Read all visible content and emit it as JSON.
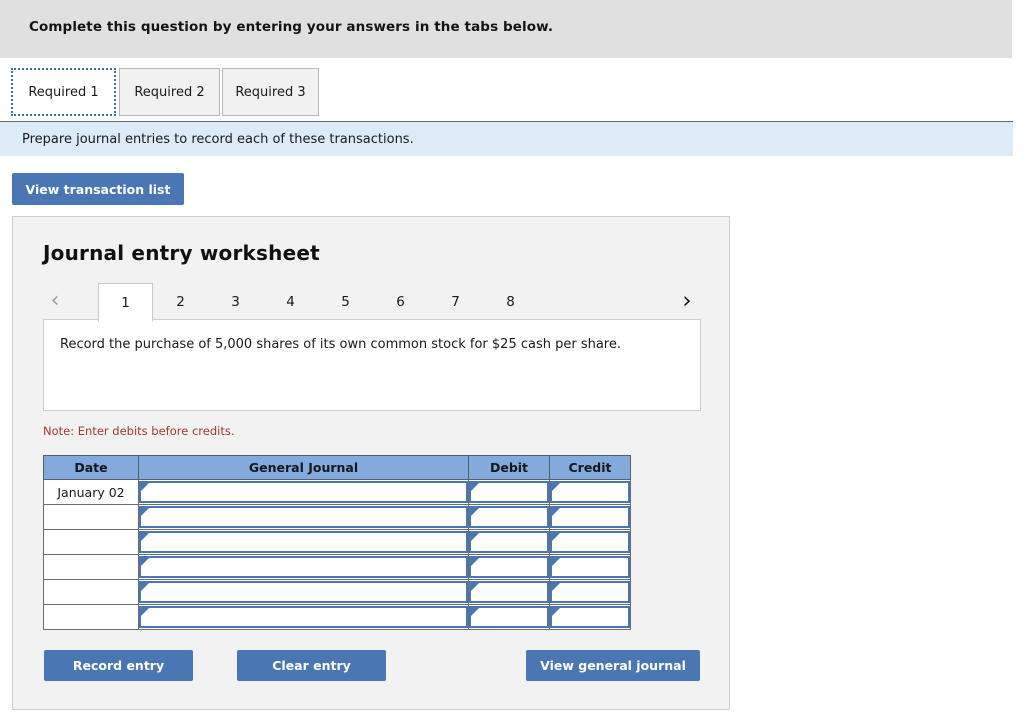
{
  "banner": {
    "text": "Complete this question by entering your answers in the tabs below."
  },
  "required_tabs": [
    {
      "label": "Required 1",
      "active": true
    },
    {
      "label": "Required 2",
      "active": false
    },
    {
      "label": "Required 3",
      "active": false
    }
  ],
  "requirement": {
    "description": "Prepare journal entries to record each of these transactions."
  },
  "toolbar": {
    "view_transaction_list_label": "View transaction list"
  },
  "worksheet": {
    "title": "Journal entry worksheet",
    "pager": {
      "prev_icon": "chevron-left-icon",
      "next_icon": "chevron-right-icon",
      "prev_glyph": "‹",
      "next_glyph": "›",
      "pages": [
        "1",
        "2",
        "3",
        "4",
        "5",
        "6",
        "7",
        "8"
      ],
      "active_page": "1"
    },
    "transaction_text": "Record the purchase of 5,000 shares of its own common stock for $25 cash per share.",
    "note": "Note: Enter debits before credits.",
    "table": {
      "headers": [
        "Date",
        "General Journal",
        "Debit",
        "Credit"
      ],
      "rows": [
        {
          "date": "January 02",
          "general_journal": "",
          "debit": "",
          "credit": ""
        },
        {
          "date": "",
          "general_journal": "",
          "debit": "",
          "credit": ""
        },
        {
          "date": "",
          "general_journal": "",
          "debit": "",
          "credit": ""
        },
        {
          "date": "",
          "general_journal": "",
          "debit": "",
          "credit": ""
        },
        {
          "date": "",
          "general_journal": "",
          "debit": "",
          "credit": ""
        },
        {
          "date": "",
          "general_journal": "",
          "debit": "",
          "credit": ""
        }
      ]
    },
    "buttons": {
      "record_entry": "Record entry",
      "clear_entry": "Clear entry",
      "view_general_journal": "View general journal"
    }
  },
  "colors": {
    "banner_gray": "#e0e0e0",
    "requirement_blue": "#ddeaf7",
    "button_blue": "#4a77b4",
    "table_header_blue": "#84a9dd",
    "note_red": "#a33a33",
    "panel_gray": "#f2f2f2"
  }
}
